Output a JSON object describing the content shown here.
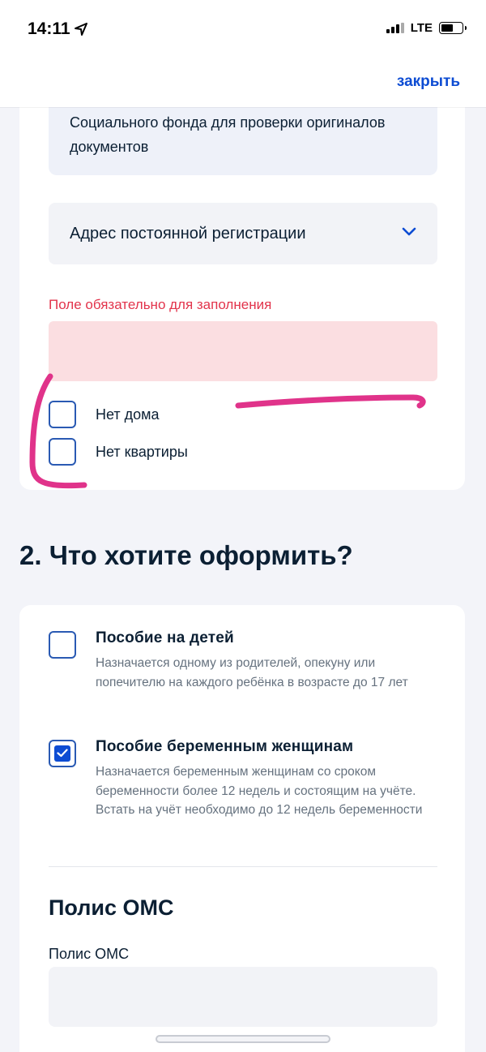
{
  "status_bar": {
    "time": "14:11",
    "network": "LTE"
  },
  "header": {
    "close_label": "закрыть"
  },
  "address_card": {
    "info_text": "Социального фонда для проверки оригиналов документов",
    "select_label": "Адрес постоянной регистрации",
    "error_text": "Поле обязательно для заполнения",
    "input_value": "",
    "checkboxes": [
      {
        "label": "Нет дома",
        "checked": false
      },
      {
        "label": "Нет квартиры",
        "checked": false
      }
    ]
  },
  "section": {
    "title": "2. Что хотите оформить?"
  },
  "benefits_card": {
    "options": [
      {
        "title": "Пособие на детей",
        "description": "Назначается одному из родителей, опекуну или попечителю на каждого ребёнка в возрасте до 17 лет",
        "checked": false
      },
      {
        "title": "Пособие беременным женщинам",
        "description": "Назначается беременным женщинам со сроком беременности более 12 недель и состоящим на учёте. Встать на учёт необходимо до 12 недель беременности",
        "checked": true
      }
    ],
    "oms_heading": "Полис ОМС",
    "oms_label": "Полис ОМС",
    "oms_value": ""
  },
  "colors": {
    "accent": "#0d4cd3",
    "error": "#e2334b",
    "error_bg": "#fbdee1",
    "annotation": "#e0338a"
  },
  "icons": {
    "location": "location-arrow-icon",
    "chevron": "chevron-down-icon",
    "check": "check-icon"
  }
}
